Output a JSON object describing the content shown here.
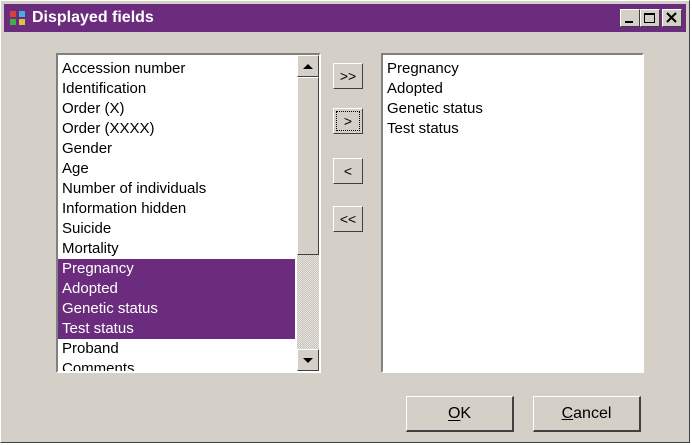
{
  "window": {
    "title": "Displayed fields",
    "controls": [
      "minimize-icon",
      "maximize-icon",
      "close-icon"
    ],
    "title_bar_color": "#6b2c7e"
  },
  "available_fields": {
    "items": [
      {
        "label": "Accession number",
        "selected": false
      },
      {
        "label": "Identification",
        "selected": false
      },
      {
        "label": "Order (X)",
        "selected": false
      },
      {
        "label": "Order (XXXX)",
        "selected": false
      },
      {
        "label": "Gender",
        "selected": false
      },
      {
        "label": "Age",
        "selected": false
      },
      {
        "label": "Number of individuals",
        "selected": false
      },
      {
        "label": "Information hidden",
        "selected": false
      },
      {
        "label": "Suicide",
        "selected": false
      },
      {
        "label": "Mortality",
        "selected": false
      },
      {
        "label": "Pregnancy",
        "selected": true
      },
      {
        "label": "Adopted",
        "selected": true
      },
      {
        "label": "Genetic status",
        "selected": true
      },
      {
        "label": "Test status",
        "selected": true
      },
      {
        "label": "Proband",
        "selected": false
      },
      {
        "label": "Comments",
        "selected": false
      }
    ],
    "selection_color": "#6b2c7e"
  },
  "transfer_buttons": {
    "add_all": ">>",
    "add": ">",
    "remove": "<",
    "remove_all": "<<"
  },
  "displayed_fields": {
    "items": [
      "Pregnancy",
      "Adopted",
      "Genetic status",
      "Test status"
    ]
  },
  "actions": {
    "ok": "OK",
    "cancel": "Cancel"
  }
}
